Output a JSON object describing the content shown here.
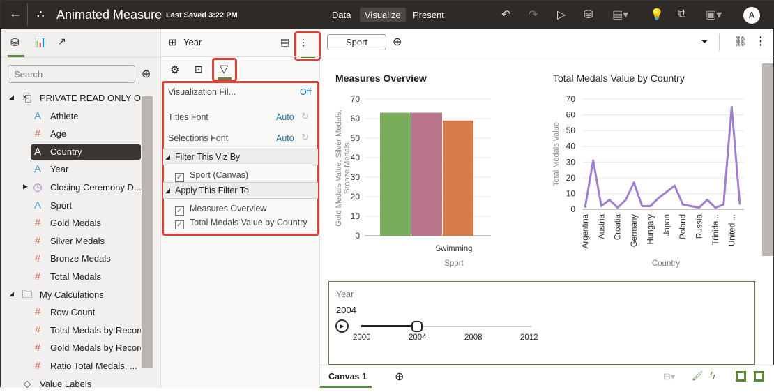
{
  "header": {
    "back_icon": "arrow-left-icon",
    "title": "Animated Measure",
    "last_saved": "Last Saved 3:22 PM",
    "nav": [
      "Data",
      "Visualize",
      "Present"
    ],
    "active_nav": "Visualize",
    "avatar": "A"
  },
  "left_panel": {
    "search_placeholder": "Search",
    "items": [
      {
        "label": "PRIVATE READ ONLY OI...",
        "type": "dataset",
        "level": 0
      },
      {
        "label": "Athlete",
        "type": "attribute",
        "level": 1
      },
      {
        "label": "Age",
        "type": "measure",
        "level": 1
      },
      {
        "label": "Country",
        "type": "attribute",
        "level": 1,
        "selected": true
      },
      {
        "label": "Year",
        "type": "attribute",
        "level": 1
      },
      {
        "label": "Closing Ceremony D...",
        "type": "date",
        "level": 1
      },
      {
        "label": "Sport",
        "type": "attribute",
        "level": 1
      },
      {
        "label": "Gold Medals",
        "type": "measure",
        "level": 1
      },
      {
        "label": "Silver Medals",
        "type": "measure",
        "level": 1
      },
      {
        "label": "Bronze Medals",
        "type": "measure",
        "level": 1
      },
      {
        "label": "Total Medals",
        "type": "measure",
        "level": 1
      },
      {
        "label": "My Calculations",
        "type": "folder",
        "level": 0
      },
      {
        "label": "Row Count",
        "type": "measure",
        "level": 1
      },
      {
        "label": "Total Medals by Record",
        "type": "measure",
        "level": 1
      },
      {
        "label": "Gold Medals by Record",
        "type": "measure",
        "level": 1
      },
      {
        "label": "Ratio Total Medals, ...",
        "type": "measure",
        "level": 1
      },
      {
        "label": "Value Labels",
        "type": "tag",
        "level": 0
      }
    ]
  },
  "middle_panel": {
    "viz_name": "Year",
    "properties": [
      {
        "label": "Visualization Fil...",
        "value": "Off"
      },
      {
        "label": "Titles Font",
        "value": "Auto"
      },
      {
        "label": "Selections Font",
        "value": "Auto"
      }
    ],
    "filter_section": "Filter This Viz By",
    "filter_items": [
      "Sport (Canvas)"
    ],
    "apply_section": "Apply This Filter To",
    "apply_items": [
      "Measures Overview",
      "Total Medals Value by Country"
    ]
  },
  "canvas": {
    "filter_pill": "Sport",
    "tab": "Canvas 1",
    "slider": {
      "title": "Year",
      "value": "2004",
      "ticks": [
        "2000",
        "2004",
        "2008",
        "2012"
      ],
      "min": 2000,
      "max": 2012,
      "current": 2004
    }
  },
  "colors": {
    "accent": "#5a8a3a",
    "highlight": "#d9403a",
    "gold": "#78ac5a",
    "silver": "#b87488",
    "bronze": "#d77a4a",
    "line": "#a07fd0"
  },
  "chart_data": [
    {
      "type": "bar",
      "title": "Measures Overview",
      "categories": [
        "Swimming"
      ],
      "xlabel": "Sport",
      "ylabel": "Gold Medals Value, Silver Medals, Bronze Medals",
      "ylim": [
        0,
        70
      ],
      "yticks": [
        "0",
        "10",
        "20",
        "30",
        "40",
        "50",
        "60",
        "70"
      ],
      "series": [
        {
          "values": [
            63
          ]
        },
        {
          "values": [
            63
          ]
        },
        {
          "values": [
            59
          ]
        }
      ],
      "grid": true
    },
    {
      "type": "line",
      "title": "Total Medals Value by Country",
      "xlabel": "Country",
      "ylabel": "Total Medals Value",
      "ylim": [
        0,
        70
      ],
      "yticks": [
        "0",
        "10",
        "20",
        "30",
        "40",
        "50",
        "60",
        "70"
      ],
      "xticks": [
        "Argentina",
        "Austria",
        "Croatia",
        "Germany",
        "Hungary",
        "Japan",
        "Poland",
        "Russia",
        "Trinida...",
        "United ..."
      ],
      "values": [
        1,
        31,
        2,
        6,
        1,
        6,
        17,
        2,
        2,
        7,
        11,
        15,
        3,
        2,
        1,
        6,
        1,
        3,
        65,
        3
      ],
      "grid": true
    }
  ]
}
